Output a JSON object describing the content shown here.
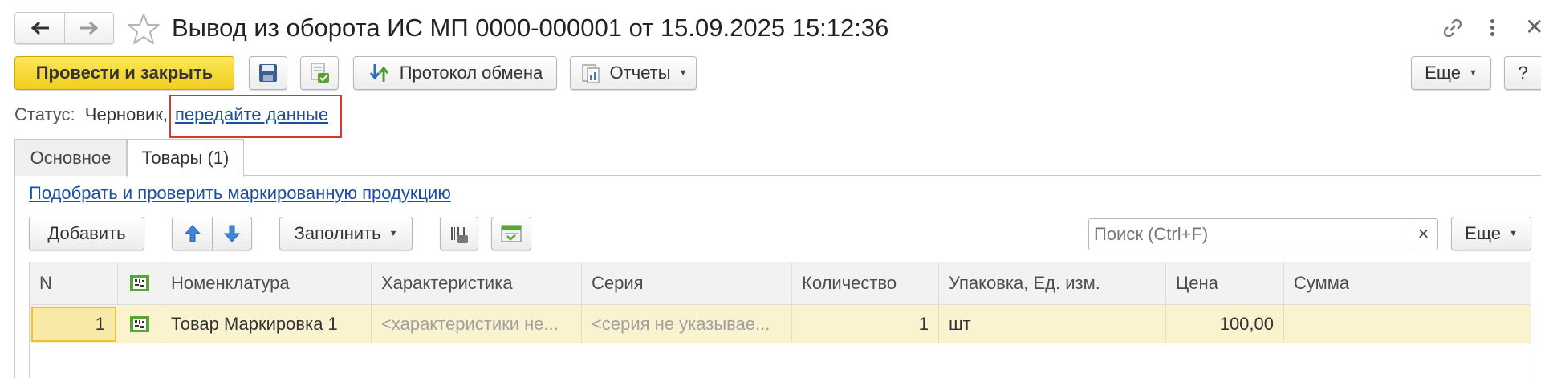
{
  "window": {
    "title": "Вывод из оборота ИС МП 0000-000001 от 15.09.2025 15:12:36",
    "more_icon": "dots-vertical-icon",
    "link_icon": "link-icon"
  },
  "toolbar": {
    "post_close": "Провести и закрыть",
    "exchange_protocol": "Протокол обмена",
    "reports": "Отчеты",
    "more": "Еще",
    "help": "?"
  },
  "status": {
    "label": "Статус:",
    "value": "Черновик,",
    "link": "передайте данные"
  },
  "tabs": [
    {
      "label": "Основное",
      "active": false
    },
    {
      "label": "Товары (1)",
      "active": true
    }
  ],
  "goods": {
    "pick_link": "Подобрать и проверить маркированную продукцию",
    "add": "Добавить",
    "fill": "Заполнить",
    "search_placeholder": "Поиск (Ctrl+F)",
    "clear": "×",
    "more": "Еще"
  },
  "table": {
    "columns": [
      "N",
      "",
      "Номенклатура",
      "Характеристика",
      "Серия",
      "Количество",
      "Упаковка, Ед. изм.",
      "Цена",
      "Сумма"
    ],
    "rows": [
      {
        "n": "1",
        "name": "Товар Маркировка 1",
        "characteristic": "<характеристики не...",
        "series": "<серия не указывае...",
        "quantity": "1",
        "unit": "шт",
        "price": "100,00",
        "sum": ""
      }
    ]
  },
  "colors": {
    "primary_button": "#f5d934",
    "link": "#1c4e9e",
    "selected_row": "#fbf3d0",
    "highlight_box": "#d9382c"
  }
}
